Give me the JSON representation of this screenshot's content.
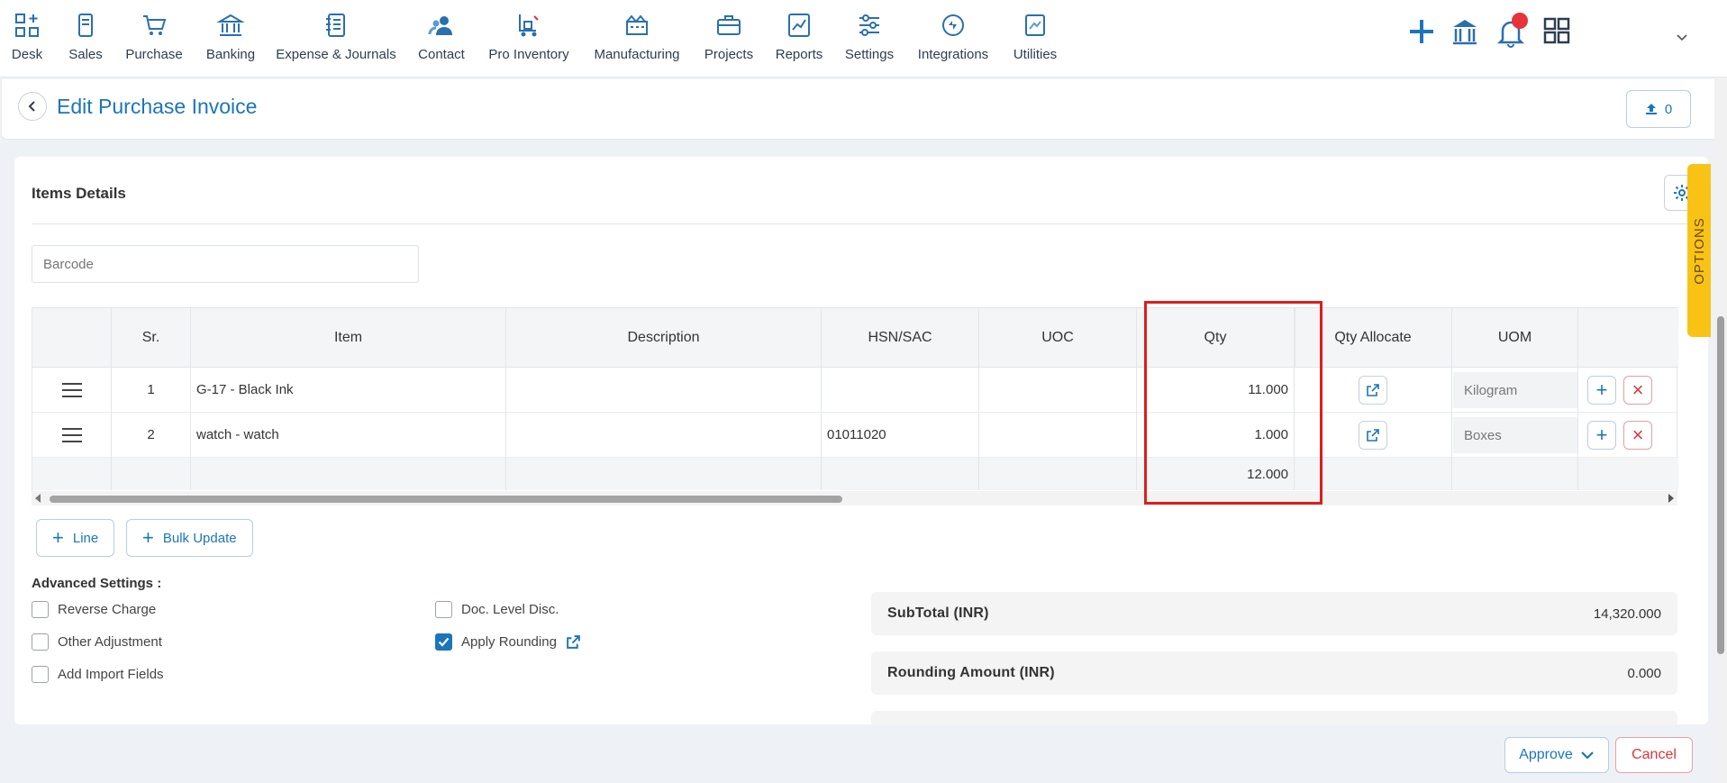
{
  "nav": {
    "items": [
      {
        "label": "Desk",
        "icon": "desk-icon"
      },
      {
        "label": "Sales",
        "icon": "sales-icon"
      },
      {
        "label": "Purchase",
        "icon": "cart-icon"
      },
      {
        "label": "Banking",
        "icon": "bank-icon"
      },
      {
        "label": "Expense & Journals",
        "icon": "journal-icon"
      },
      {
        "label": "Contact",
        "icon": "contact-icon"
      },
      {
        "label": "Pro Inventory",
        "icon": "inventory-icon"
      },
      {
        "label": "Manufacturing",
        "icon": "factory-icon"
      },
      {
        "label": "Projects",
        "icon": "briefcase-icon"
      },
      {
        "label": "Reports",
        "icon": "chart-icon"
      },
      {
        "label": "Settings",
        "icon": "sliders-icon"
      },
      {
        "label": "Integrations",
        "icon": "integrations-icon"
      },
      {
        "label": "Utilities",
        "icon": "utilities-icon"
      }
    ]
  },
  "header": {
    "title": "Edit Purchase Invoice",
    "attachments_count": "0"
  },
  "items_section": {
    "title": "Items Details",
    "barcode_placeholder": "Barcode",
    "columns": [
      "",
      "Sr.",
      "Item",
      "Description",
      "HSN/SAC",
      "UOC",
      "Qty",
      "",
      "Qty Allocate",
      "UOM",
      ""
    ],
    "rows": [
      {
        "sr": "1",
        "item": "G-17 - Black Ink",
        "description": "",
        "hsn": "",
        "uoc": "",
        "qty": "11.000",
        "uom": "Kilogram"
      },
      {
        "sr": "2",
        "item": "watch - watch",
        "description": "",
        "hsn": "01011020",
        "uoc": "",
        "qty": "1.000",
        "uom": "Boxes"
      }
    ],
    "total_qty": "12.000",
    "line_button": "Line",
    "bulk_update_button": "Bulk Update"
  },
  "advanced": {
    "title": "Advanced Settings :",
    "reverse_charge": "Reverse Charge",
    "other_adjustment": "Other Adjustment",
    "add_import_fields": "Add Import Fields",
    "doc_level_disc": "Doc. Level Disc.",
    "apply_rounding": "Apply Rounding"
  },
  "summary": {
    "subtotal_label": "SubTotal (INR)",
    "subtotal_value": "14,320.000",
    "rounding_label": "Rounding Amount (INR)",
    "rounding_value": "0.000"
  },
  "options_tab": "OPTIONS",
  "footer": {
    "approve": "Approve",
    "cancel": "Cancel"
  },
  "colors": {
    "accent": "#1b76b9",
    "danger": "#d9363e",
    "options": "#f9c316",
    "highlight": "#e11c1c"
  }
}
